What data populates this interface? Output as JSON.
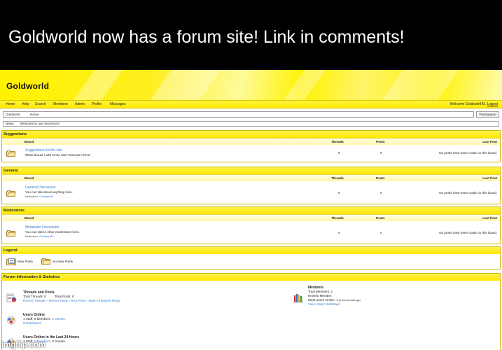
{
  "caption": "Goldworld now has a forum site! Link in comments!",
  "site": {
    "logo": "Goldworld"
  },
  "nav": {
    "items": [
      "Home",
      "Help",
      "Search",
      "Members",
      "Admin",
      "Profile",
      "Messages"
    ],
    "welcome_prefix": "Welcome Goldside543.",
    "logout": "Logout"
  },
  "breadcrumb": {
    "root": "Goldworld",
    "current": "Home",
    "participated": "Participated"
  },
  "news": {
    "label": "News",
    "text": "Welcome to our new forum!"
  },
  "columns": {
    "board": "Board",
    "threads": "Threads",
    "posts": "Posts",
    "last_post": "Last Post"
  },
  "categories": [
    {
      "title": "Suggestions",
      "board": {
        "name": "Suggestions for the site",
        "description": "What should I add to the site? Discuss it here!",
        "moderators": "",
        "threads": "0",
        "posts": "0",
        "last_post": "No posts have been made on this board."
      }
    },
    {
      "title": "General",
      "board": {
        "name": "General Discussion",
        "description": "You can talk about anything here.",
        "moderators_label": "Moderators:",
        "moderators": "Goldside543",
        "threads": "0",
        "posts": "0",
        "last_post": "No posts have been made on this board."
      }
    },
    {
      "title": "Moderators",
      "board": {
        "name": "Moderator Discussion",
        "description": "You can talk to other moderators here.",
        "moderators_label": "Moderators:",
        "moderators": "Goldside543",
        "threads": "0",
        "posts": "0",
        "last_post": "No posts have been made on this board."
      }
    }
  ],
  "legend": {
    "title": "Legend",
    "new_posts": "New Posts",
    "no_new_posts": "No New Posts"
  },
  "info": {
    "title": "Forum Information & Statistics",
    "threads_posts": {
      "title": "Threads and Posts",
      "total_threads": "Total Threads: 0",
      "total_posts": "Total Posts: 0",
      "links": [
        "Recent Threads",
        "Recent Posts",
        "RSS Feed",
        "Mark All Boards Read"
      ]
    },
    "members": {
      "title": "Members",
      "total": "Total Members: 1",
      "newest": "Newest Member:",
      "most_online": "Most Users Online: 1",
      "most_online_when": "(a few seconds ago)",
      "birthdays": "View today's birthdays"
    },
    "users_online": {
      "title": "Users Online",
      "line_prefix": "1 Staff, 0 Members,",
      "guests": "0 Guests.",
      "user": "Goldside543"
    },
    "last24": {
      "title": "Users Online in the Last 24 Hours",
      "line_prefix": "1 Staff,",
      "members": "0 Members",
      "line_suffix": ", 0 Guests."
    }
  },
  "watermark": "imgflip.com",
  "colors": {
    "yellow": "#fff200",
    "link": "#3a80d0",
    "caption_bg": "#000000"
  }
}
